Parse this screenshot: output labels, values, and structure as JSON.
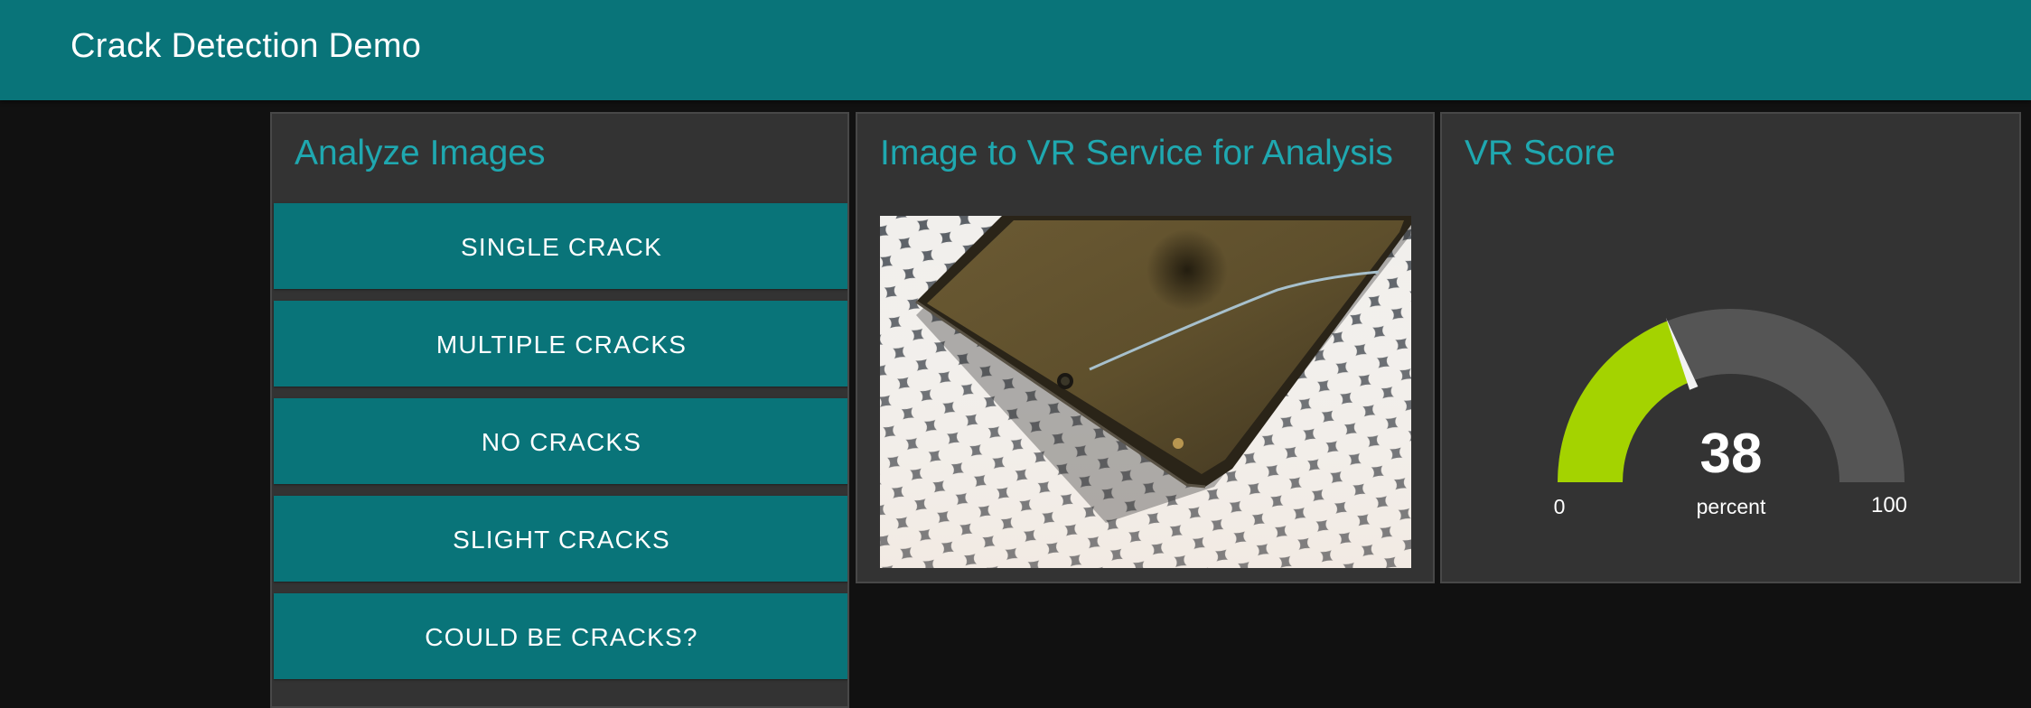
{
  "header": {
    "title": "Crack Detection Demo"
  },
  "analyze": {
    "title": "Analyze Images",
    "buttons": [
      {
        "label": "SINGLE CRACK"
      },
      {
        "label": "MULTIPLE CRACKS"
      },
      {
        "label": "NO CRACKS"
      },
      {
        "label": "SLIGHT CRACKS"
      },
      {
        "label": "COULD BE CRACKS?"
      }
    ]
  },
  "image_panel": {
    "title": "Image to VR Service for Analysis",
    "photo_icon": "cracked-phone-photo"
  },
  "score": {
    "title": "VR Score",
    "value": "38",
    "units": "percent",
    "min": "0",
    "max": "100",
    "fraction": 0.38,
    "colors": {
      "fill": "#a4d300",
      "track": "#555555",
      "needle": "#f2f2f2"
    }
  },
  "colors": {
    "accent": "#097479",
    "title_text": "#1fa8b0",
    "panel_bg": "#333333",
    "page_bg": "#111111"
  }
}
